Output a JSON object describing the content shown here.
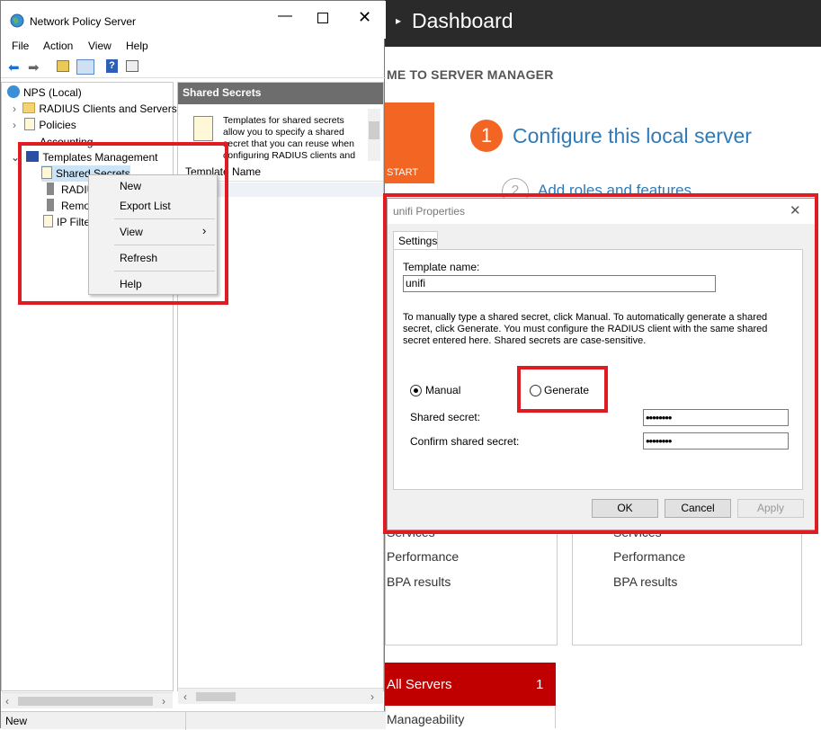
{
  "server_manager": {
    "title": "Dashboard",
    "welcome": "ME TO SERVER MANAGER",
    "quick_start": "START",
    "step1_num": "1",
    "step1": "Configure this local server",
    "step2_num": "2",
    "step2": "Add roles and features",
    "tile_left": {
      "services": "Services",
      "performance": "Performance",
      "bpa": "BPA results"
    },
    "tile_right": {
      "services": "Services",
      "performance": "Performance",
      "bpa": "BPA results"
    },
    "all_servers": "All Servers",
    "all_servers_count": "1",
    "manageability": "Manageability"
  },
  "nps": {
    "title": "Network Policy Server",
    "menu": [
      "File",
      "Action",
      "View",
      "Help"
    ],
    "tree": {
      "root": "NPS (Local)",
      "radius_clients": "RADIUS Clients and Servers",
      "policies": "Policies",
      "accounting": "Accounting",
      "templates": "Templates Management",
      "shared_secrets": "Shared Secrets",
      "radius": "RADIU",
      "remote": "Remo",
      "ip_filters": "IP Filte"
    },
    "pane_header": "Shared Secrets",
    "pane_desc": "Templates for shared secrets allow you to specify a shared secret that you can reuse when configuring RADIUS clients and",
    "column_header": "Template Name",
    "status": "New"
  },
  "context_menu": {
    "new": "New",
    "export": "Export List",
    "view": "View",
    "refresh": "Refresh",
    "help": "Help"
  },
  "dialog": {
    "title": "unifi Properties",
    "tab": "Settings",
    "template_label": "Template name:",
    "template_value": "unifi",
    "description": "To manually type a shared secret, click Manual. To automatically generate a shared secret, click Generate. You must configure the RADIUS client with the same shared secret entered here. Shared secrets are case-sensitive.",
    "manual": "Manual",
    "generate": "Generate",
    "manual_selected": true,
    "shared_label": "Shared secret:",
    "shared_value": "••••••••",
    "confirm_label": "Confirm shared secret:",
    "confirm_value": "••••••••",
    "ok": "OK",
    "cancel": "Cancel",
    "apply": "Apply"
  },
  "colors": {
    "accent_orange": "#f26522",
    "highlight_red": "#e11b22",
    "link_blue": "#2f7ab8",
    "server_red": "#c00000"
  }
}
